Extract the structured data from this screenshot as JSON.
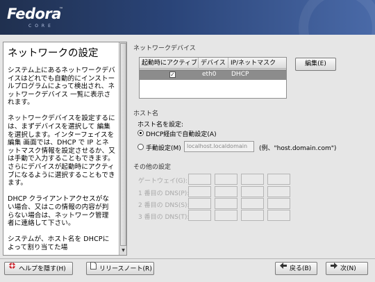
{
  "header": {
    "logo": "Fedora",
    "logo_tm": "™",
    "logo_sub": "CORE"
  },
  "help": {
    "title": "ネットワークの設定",
    "paragraphs": [
      "システム上にあるネットワークデバイスはどれでも自動的にインストールプログラムによって検出され、ネットワークデバイス 一覧に表示されます。",
      "ネットワークデバイスを設定するには、まずデバイスを選択して 編集 を選択します。インターフェイスを編集 画面では、DHCP で IP とネットマスク情報を設定させるか、又は手動で入力することもできます。さらにデバイスが起動時にアクティブになるように選択することもできます。",
      "DHCP クライアントアクセスがない場合、又はこの情報の内容が判らない場合は、ネットワーク管理者に連絡して下さい。",
      "システムが、ホスト名を DHCPによって割り当てた場"
    ]
  },
  "network_devices": {
    "section_label": "ネットワークデバイス",
    "columns": [
      "起動時にアクティブ",
      "デバイス",
      "IP/ネットマスク"
    ],
    "rows": [
      {
        "active": true,
        "device": "eth0",
        "ip": "DHCP"
      }
    ],
    "edit_button": "編集(E)"
  },
  "hostname": {
    "section_label": "ホスト名",
    "set_label": "ホスト名を設定:",
    "dhcp_option": "DHCP経由で自動設定(A)",
    "manual_option": "手動設定(M)",
    "manual_value": "localhost.localdomain",
    "example": "(例、\"host.domain.com\")",
    "selected": "dhcp"
  },
  "other": {
    "section_label": "その他の設定",
    "fields": [
      "ゲートウェイ(G):",
      "1 番目の DNS(P):",
      "2 番目の DNS(S):",
      "3 番目の DNS(T):"
    ]
  },
  "footer": {
    "hide_help": "ヘルプを隠す(H)",
    "release_notes": "リリースノート(R)",
    "back": "戻る(B)",
    "next": "次(N)"
  },
  "colors": {
    "banner": "#2a4478",
    "selected_row": "#8c8c8c"
  }
}
